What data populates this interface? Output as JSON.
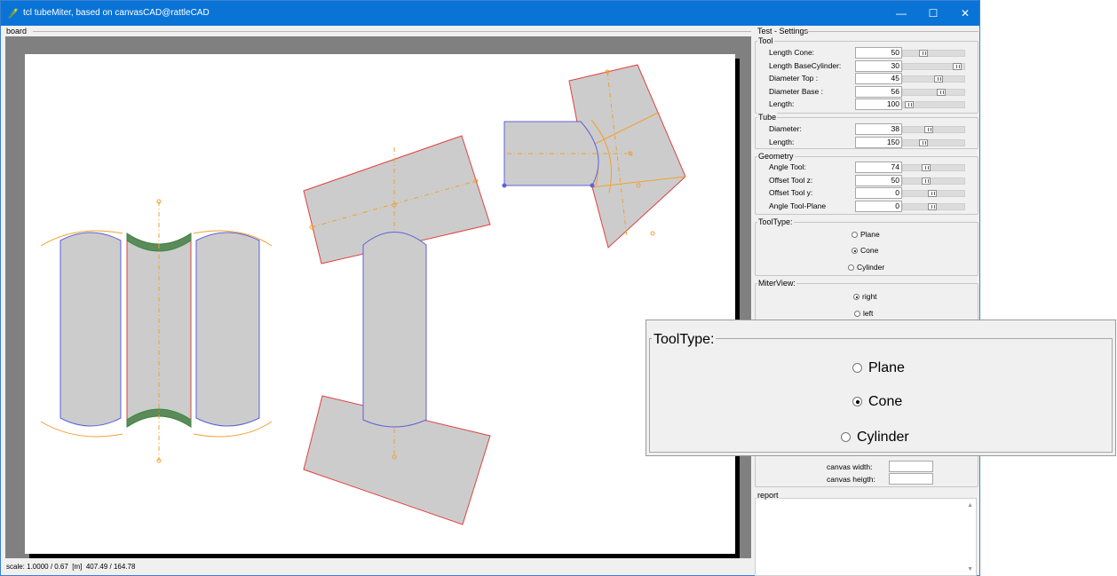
{
  "window": {
    "title": "tcl tubeMiter, based on canvasCAD@rattleCAD",
    "controls": {
      "minimize": "—",
      "maximize": "☐",
      "close": "✕"
    }
  },
  "board": {
    "label": "board",
    "status": "scale: 1.0000 / 0.67  [m]  407.49 / 164.78"
  },
  "settings": {
    "title": "Test - Settings",
    "tool": {
      "label": "Tool",
      "params": [
        {
          "name": "Length Cone:",
          "value": "50",
          "slider": 0.3
        },
        {
          "name": "Length BaseCylinder:",
          "value": "30",
          "slider": 0.95
        },
        {
          "name": "Diameter Top  :",
          "value": "45",
          "slider": 0.6
        },
        {
          "name": "Diameter Base :",
          "value": "56",
          "slider": 0.65
        },
        {
          "name": "Length:",
          "value": "100",
          "slider": 0.03
        }
      ]
    },
    "tube": {
      "label": "Tube",
      "params": [
        {
          "name": "Diameter:",
          "value": "38",
          "slider": 0.4
        },
        {
          "name": "Length:",
          "value": "150",
          "slider": 0.3
        }
      ]
    },
    "geometry": {
      "label": "Geometry",
      "params": [
        {
          "name": "Angle Tool:",
          "value": "74",
          "slider": 0.35
        },
        {
          "name": "Offset Tool z:",
          "value": "50",
          "slider": 0.35
        },
        {
          "name": "Offset Tool y:",
          "value": "0",
          "slider": 0.48
        },
        {
          "name": "Angle Tool-Plane",
          "value": "0",
          "slider": 0.48
        }
      ]
    },
    "tooltype": {
      "label": "ToolType:",
      "options": [
        "Plane",
        "Cone",
        "Cylinder"
      ],
      "selected": "Cone"
    },
    "miterview": {
      "label": "MiterView:",
      "options": [
        "right",
        "left"
      ],
      "selected": "right"
    },
    "status": {
      "canvas_width_label": "canvas width:",
      "canvas_height_label": "canvas heigth:"
    },
    "report": {
      "label": "report"
    }
  },
  "zoom": {
    "label": "ToolType:",
    "options": [
      "Plane",
      "Cone",
      "Cylinder"
    ],
    "selected": "Cone"
  },
  "colors": {
    "titlebar": "#0a74d6",
    "board_bg": "#808080",
    "shape_fill": "#cccccc",
    "outline_blue": "#6060d8",
    "outline_red": "#e04040",
    "outline_orange": "#f0a030",
    "outline_green": "#2e8b3c"
  }
}
